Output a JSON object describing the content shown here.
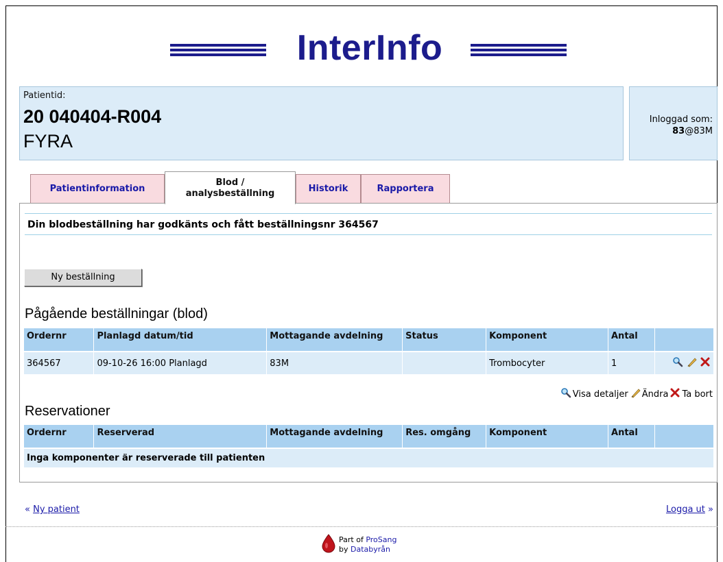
{
  "logo": {
    "text": "InterInfo"
  },
  "patient": {
    "label": "Patientid:",
    "id": "20 040404-R004",
    "name": "FYRA"
  },
  "login": {
    "label": "Inloggad som:",
    "user": "83",
    "unit": "@83M"
  },
  "tabs": [
    {
      "line1": "Patientinformation",
      "line2": ""
    },
    {
      "line1": "Blod /",
      "line2": "analysbeställning"
    },
    {
      "line1": "Historik",
      "line2": ""
    },
    {
      "line1": "Rapportera",
      "line2": ""
    }
  ],
  "message": "Din blodbeställning har godkänts och fått beställningsnr 364567",
  "new_order_button": "Ny beställning",
  "orders": {
    "title": "Pågående beställningar (blod)",
    "headers": [
      "Ordernr",
      "Planlagd datum/tid",
      "Mottagande avdelning",
      "Status",
      "Komponent",
      "Antal",
      ""
    ],
    "rows": [
      {
        "ordernr": "364567",
        "datetime": "09-10-26 16:00 Planlagd",
        "avdelning": "83M",
        "status": "",
        "komponent": "Trombocyter",
        "antal": "1"
      }
    ]
  },
  "legend": {
    "view": "Visa detaljer",
    "edit": "Ändra",
    "delete": "Ta bort"
  },
  "reservations": {
    "title": "Reservationer",
    "headers": [
      "Ordernr",
      "Reserverad",
      "Mottagande avdelning",
      "Res. omgång",
      "Komponent",
      "Antal",
      ""
    ],
    "empty": "Inga komponenter är reserverade till patienten"
  },
  "footer": {
    "new_patient": "Ny patient",
    "logout": "Logga ut",
    "part_of": "Part of",
    "prosang": "ProSang",
    "by": "by",
    "databyran": "Databyrån"
  },
  "colors": {
    "brand": "#1c1c8c",
    "header_bg": "#dcecf8",
    "table_header": "#a9d1f0",
    "tab_inactive": "#f9dbe0"
  }
}
